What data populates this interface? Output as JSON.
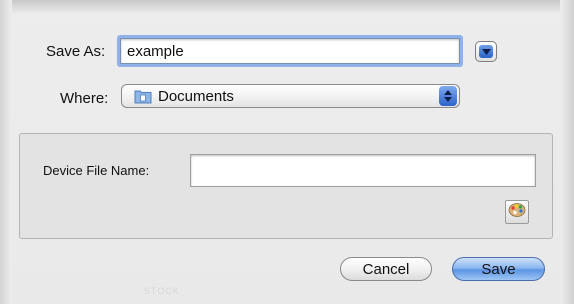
{
  "save_as": {
    "label": "Save As:",
    "value": "example"
  },
  "where": {
    "label": "Where:",
    "value": "Documents",
    "folder_icon": "folder-icon"
  },
  "device": {
    "label": "Device File Name:",
    "value": "",
    "palette_icon": "palette-icon"
  },
  "buttons": {
    "cancel": "Cancel",
    "save": "Save"
  },
  "watermark": "STOCK",
  "colors": {
    "focus_ring": "#8fb2e8",
    "default_button": "#5b95e2",
    "background": "#ededed"
  }
}
